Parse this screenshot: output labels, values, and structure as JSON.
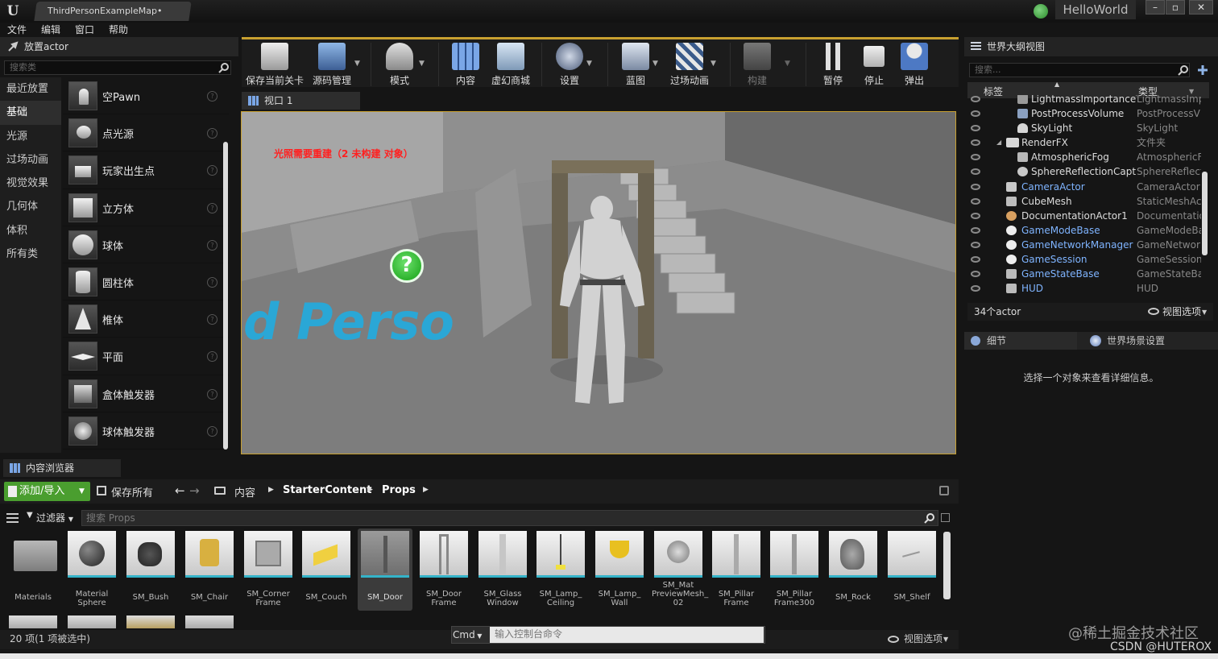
{
  "window": {
    "logo": "U",
    "tab_title": "ThirdPersonExampleMap•",
    "project_name": "HelloWorld",
    "controls": [
      "–",
      "▫",
      "✕"
    ]
  },
  "menu": [
    "文件",
    "编辑",
    "窗口",
    "帮助"
  ],
  "place_panel": {
    "title": "放置actor",
    "search_placeholder": "搜索类",
    "categories": [
      "最近放置",
      "基础",
      "光源",
      "过场动画",
      "视觉效果",
      "几何体",
      "体积",
      "所有类"
    ],
    "selected_category": "基础",
    "items": [
      "空Pawn",
      "点光源",
      "玩家出生点",
      "立方体",
      "球体",
      "圆柱体",
      "椎体",
      "平面",
      "盒体触发器",
      "球体触发器"
    ]
  },
  "toolbar": [
    "保存当前关卡",
    "源码管理",
    "模式",
    "内容",
    "虚幻商城",
    "设置",
    "蓝图",
    "过场动画",
    "构建",
    "暂停",
    "停止",
    "弹出"
  ],
  "viewport": {
    "tab": "视口 1",
    "warning": "光照需要重建（2 未构建 对象）",
    "floor_text": "d Perso"
  },
  "outliner": {
    "title": "世界大纲视图",
    "search_placeholder": "搜索...",
    "col_label": "标签",
    "col_type": "类型",
    "rows": [
      {
        "name": "LightmassImportanceVolume",
        "type": "LightmassImp",
        "link": false,
        "indent": 3
      },
      {
        "name": "PostProcessVolume",
        "type": "PostProcessV",
        "link": false,
        "indent": 3
      },
      {
        "name": "SkyLight",
        "type": "SkyLight",
        "link": false,
        "indent": 3
      },
      {
        "name": "RenderFX",
        "type": "文件夹",
        "link": false,
        "indent": 2
      },
      {
        "name": "AtmosphericFog",
        "type": "AtmosphericF",
        "link": false,
        "indent": 3
      },
      {
        "name": "SphereReflectionCapture",
        "type": "SphereReflect",
        "link": false,
        "indent": 3
      },
      {
        "name": "CameraActor",
        "type": "CameraActor",
        "link": true,
        "indent": 2
      },
      {
        "name": "CubeMesh",
        "type": "StaticMeshAct",
        "link": false,
        "indent": 2
      },
      {
        "name": "DocumentationActor1",
        "type": "Documentation",
        "link": false,
        "indent": 2
      },
      {
        "name": "GameModeBase",
        "type": "GameModeBa",
        "link": true,
        "indent": 2
      },
      {
        "name": "GameNetworkManager",
        "type": "GameNetwork",
        "link": true,
        "indent": 2
      },
      {
        "name": "GameSession",
        "type": "GameSession",
        "link": true,
        "indent": 2
      },
      {
        "name": "GameStateBase",
        "type": "GameStateBas",
        "link": true,
        "indent": 2
      },
      {
        "name": "HUD",
        "type": "HUD",
        "link": true,
        "indent": 2
      }
    ],
    "count": "34个actor",
    "view_options": "视图选项"
  },
  "details": {
    "tab": "细节",
    "world_tab": "世界场景设置",
    "message": "选择一个对象来查看详细信息。"
  },
  "content_browser": {
    "tab": "内容浏览器",
    "add_import": "添加/导入",
    "save_all": "保存所有",
    "breadcrumb": [
      "内容",
      "StarterContent",
      "Props"
    ],
    "filters": "过滤器",
    "search_placeholder": "搜索 Props",
    "assets": [
      "Materials",
      "Material\nSphere",
      "SM_Bush",
      "SM_Chair",
      "SM_Corner\nFrame",
      "SM_Couch",
      "SM_Door",
      "SM_Door\nFrame",
      "SM_Glass\nWindow",
      "SM_Lamp_\nCeiling",
      "SM_Lamp_\nWall",
      "SM_Mat\nPreviewMesh_\n02",
      "SM_Pillar\nFrame",
      "SM_Pillar\nFrame300",
      "SM_Rock",
      "SM_Shelf"
    ],
    "selected_asset": "SM_Door",
    "status": "20 项(1 项被选中)",
    "view_options": "视图选项"
  },
  "console": {
    "label": "Cmd",
    "placeholder": "输入控制台命令"
  },
  "watermark": {
    "line1": "@稀土掘金技术社区",
    "line2": "CSDN @HUTEROX"
  },
  "colors": {
    "accent_gold": "#c8a030",
    "add_green": "#4a9e2f",
    "link_blue": "#7fb4ff",
    "warning_red": "#ff2020"
  }
}
